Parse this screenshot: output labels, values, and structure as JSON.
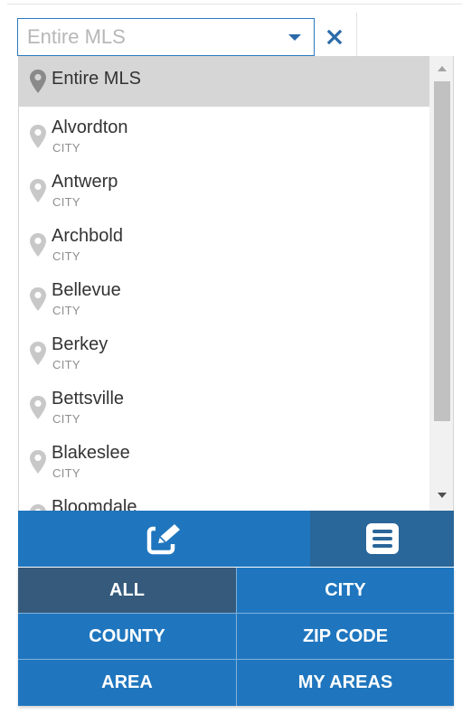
{
  "search": {
    "placeholder": "Entire MLS",
    "value": ""
  },
  "list": {
    "items": [
      {
        "name": "Entire MLS",
        "type": "",
        "selected": true
      },
      {
        "name": "Alvordton",
        "type": "CITY"
      },
      {
        "name": "Antwerp",
        "type": "CITY"
      },
      {
        "name": "Archbold",
        "type": "CITY"
      },
      {
        "name": "Bellevue",
        "type": "CITY"
      },
      {
        "name": "Berkey",
        "type": "CITY"
      },
      {
        "name": "Bettsville",
        "type": "CITY"
      },
      {
        "name": "Blakeslee",
        "type": "CITY"
      },
      {
        "name": "Bloomdale",
        "type": ""
      }
    ]
  },
  "filters": {
    "all": "ALL",
    "city": "CITY",
    "county": "COUNTY",
    "zip_code": "ZIP CODE",
    "area": "AREA",
    "my_areas": "MY AREAS"
  },
  "icons": {
    "dropdown_caret": "chevron-down-icon",
    "clear": "close-icon",
    "pin": "map-pin-icon",
    "edit": "edit-icon",
    "list": "list-icon"
  },
  "colors": {
    "accent": "#1f76be",
    "accent_dark": "#296699",
    "active_filter": "#355a7c",
    "selected_row": "#d6d6d6"
  }
}
